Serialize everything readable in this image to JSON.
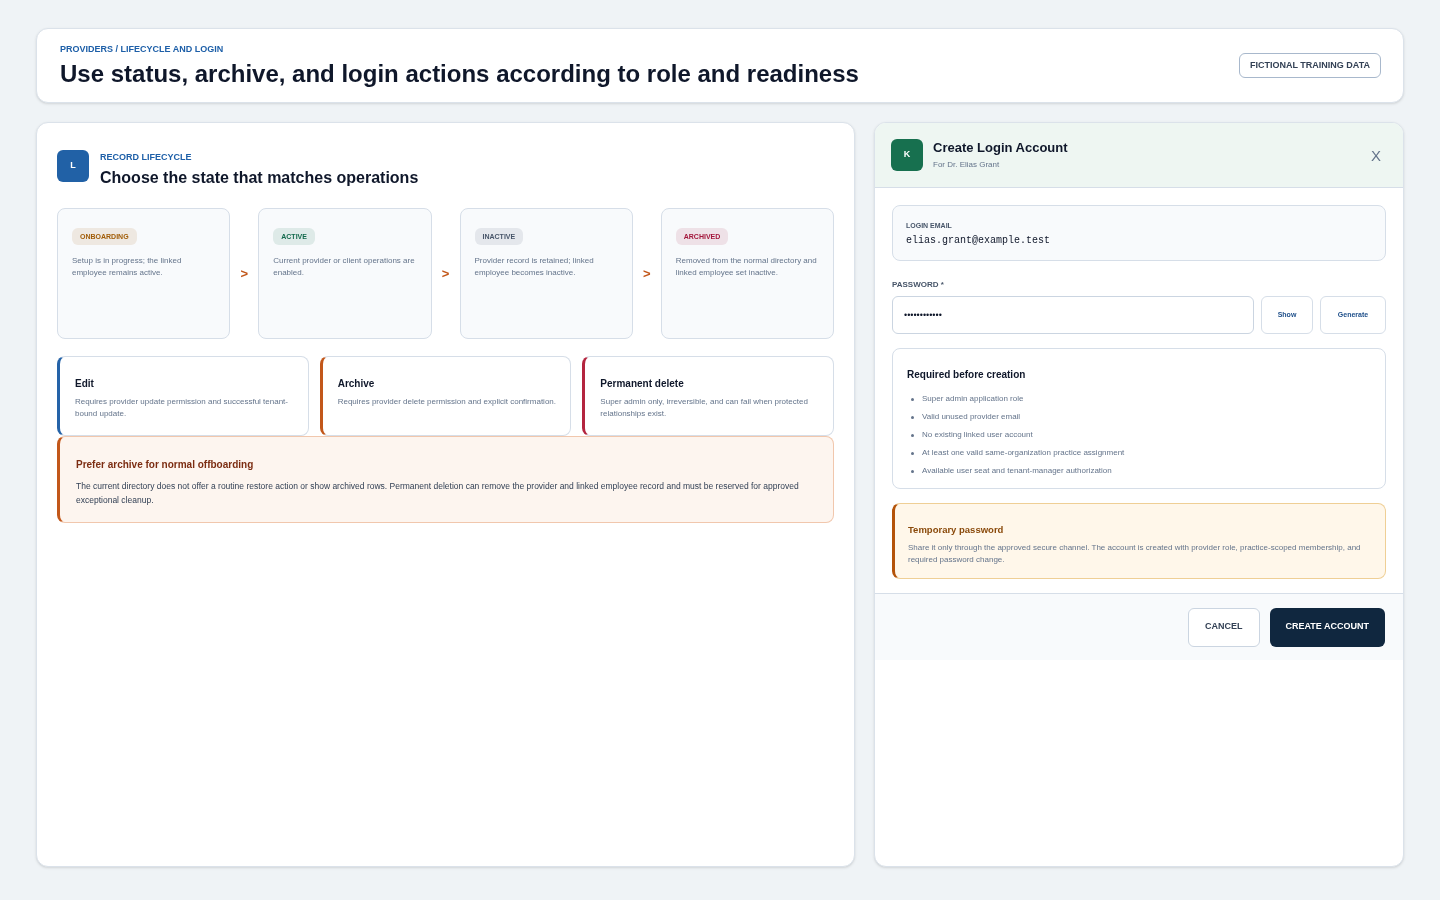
{
  "header": {
    "breadcrumb": "PROVIDERS / LIFECYCLE AND LOGIN",
    "title": "Use status, archive, and login actions according to role and readiness",
    "badge": "FICTIONAL TRAINING DATA"
  },
  "lifecycle": {
    "icon_letter": "L",
    "eyebrow": "RECORD LIFECYCLE",
    "title": "Choose the state that matches operations",
    "states": [
      {
        "label": "ONBOARDING",
        "color": "#a15c07",
        "description": "Setup is in progress; the linked employee remains active."
      },
      {
        "label": "ACTIVE",
        "color": "#12694c",
        "description": "Current provider or client operations are enabled."
      },
      {
        "label": "INACTIVE",
        "color": "#475569",
        "description": "Provider record is retained; linked employee becomes inactive."
      },
      {
        "label": "ARCHIVED",
        "color": "#a3173c",
        "description": "Removed from the normal directory and linked employee set inactive."
      }
    ],
    "arrows": [
      ">",
      ">",
      ">"
    ],
    "actions": [
      {
        "title": "Edit",
        "color": "#2563a8",
        "description": "Requires provider update permission and successful tenant-bound update."
      },
      {
        "title": "Archive",
        "color": "#c2571a",
        "description": "Requires provider delete permission and explicit confirmation."
      },
      {
        "title": "Permanent delete",
        "color": "#b4253f",
        "description": "Super admin only, irreversible, and can fail when protected relationships exist."
      }
    ],
    "callout": {
      "title": "Prefer archive for normal offboarding",
      "body": "The current directory does not offer a routine restore action or show archived rows. Permanent deletion can remove the provider and linked employee record and must be reserved for approved exceptional cleanup."
    }
  },
  "dialog": {
    "icon_letter": "K",
    "title": "Create Login Account",
    "subtitle": "For Dr. Elias Grant",
    "close": "X",
    "email": {
      "label": "LOGIN EMAIL",
      "value": "elias.grant@example.test"
    },
    "password": {
      "label": "PASSWORD *",
      "value": "••••••••••••",
      "buttons": [
        "Show",
        "Generate"
      ]
    },
    "requirements": {
      "title": "Required before creation",
      "items": [
        "Super admin application role",
        "Valid unused provider email",
        "No existing linked user account",
        "At least one valid same-organization practice assignment",
        "Available user seat and tenant-manager authorization"
      ]
    },
    "notice": {
      "title": "Temporary password",
      "body": "Share it only through the approved secure channel. The account is created with provider role, practice-scoped membership, and required password change."
    },
    "buttons": [
      {
        "label": "CANCEL",
        "kind": "secondary"
      },
      {
        "label": "CREATE ACCOUNT",
        "kind": "primary"
      }
    ]
  }
}
